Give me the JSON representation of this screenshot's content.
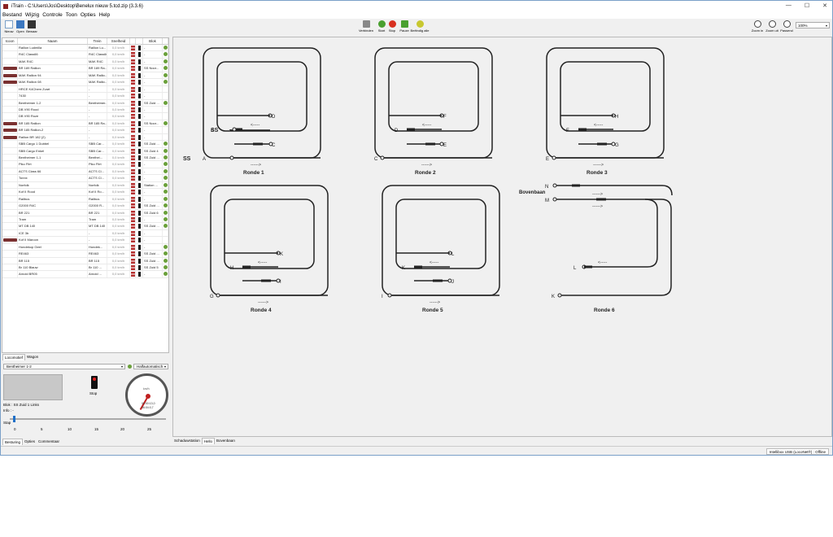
{
  "window": {
    "title": "iTrain - C:\\Users\\Jos\\Desktop\\Benelux nieuw 5.tcd.zip (3.3.6)",
    "controls": [
      "—",
      "☐",
      "✕"
    ]
  },
  "menu": [
    "Bestand",
    "Wijzig",
    "Controle",
    "Toon",
    "Opties",
    "Help"
  ],
  "toolbar": {
    "left": [
      "Nieuw",
      "Open",
      "Bewaar"
    ],
    "mid": [
      "Verbinden",
      "Start",
      "Stop",
      "Pauze",
      "Beëindig alle"
    ],
    "right": [
      "Zoom in",
      "Zoom uit",
      "Passend"
    ],
    "zoom": "100%"
  },
  "table": {
    "headers": [
      "Icoon",
      "Naam",
      "Trein",
      "Snelheid",
      "",
      "",
      "Blok",
      ""
    ],
    "rows": [
      {
        "name": "Railion Ludmilla",
        "train": "Railion Lu...",
        "speed": "0,0 km/h",
        "blk": "-",
        "loc": false,
        "dot": true
      },
      {
        "name": "R4C Class66",
        "train": "R4C Class66",
        "speed": "0,0 km/h",
        "blk": "-",
        "loc": false,
        "dot": true
      },
      {
        "name": "MAK R4C",
        "train": "MAK R4C",
        "speed": "0,0 km/h",
        "blk": "-",
        "loc": false,
        "dot": true
      },
      {
        "name": "BR 189 Railion",
        "train": "BR 189 Ra...",
        "speed": "0,0 km/h",
        "blk": "SS Noor...",
        "loc": true,
        "dot": true
      },
      {
        "name": "MAK Railion 94",
        "train": "MAK Railio...",
        "speed": "0,0 km/h",
        "blk": "-",
        "loc": true,
        "dot": true
      },
      {
        "name": "MAK Railion 08",
        "train": "MAK Railio...",
        "speed": "0,0 km/h",
        "blk": "-",
        "loc": true,
        "dot": true
      },
      {
        "name": "HRCE K4Chem Zvart",
        "train": "-",
        "speed": "0,0 km/h",
        "blk": "-",
        "loc": false,
        "dot": false
      },
      {
        "name": "7430",
        "train": "-",
        "speed": "0,0 km/h",
        "blk": "-",
        "loc": false,
        "dot": false
      },
      {
        "name": "Bentheimer 1-2",
        "train": "Bentheimer...",
        "speed": "0,0 km/h",
        "blk": "SS Zuid ...",
        "loc": false,
        "dot": true
      },
      {
        "name": "DB V90 Rood",
        "train": "-",
        "speed": "0,0 km/h",
        "blk": "-",
        "loc": false,
        "dot": false
      },
      {
        "name": "DB V90 Roze",
        "train": "-",
        "speed": "0,0 km/h",
        "blk": "-",
        "loc": false,
        "dot": false
      },
      {
        "name": "BR 185 Railion",
        "train": "BR 185 Ra...",
        "speed": "0,0 km/h",
        "blk": "SS Noor...",
        "loc": true,
        "dot": true
      },
      {
        "name": "BR 185 Railion-2",
        "train": "-",
        "speed": "0,0 km/h",
        "blk": "-",
        "loc": true,
        "dot": false
      },
      {
        "name": "Railion BR 182 (2)",
        "train": "-",
        "speed": "0,0 km/h",
        "blk": "-",
        "loc": true,
        "dot": false
      },
      {
        "name": "SBB Cargo 1 Dubbel",
        "train": "SBB Car...",
        "speed": "0,0 km/h",
        "blk": "SS Zuid ...",
        "loc": false,
        "dot": true
      },
      {
        "name": "SBB Cargo Enkel",
        "train": "SBB Car...",
        "speed": "0,0 km/h",
        "blk": "SS Zuid 4",
        "loc": false,
        "dot": true
      },
      {
        "name": "Bentheimer 1-1",
        "train": "Benthei...",
        "speed": "0,0 km/h",
        "blk": "SS Zuid ...",
        "loc": false,
        "dot": true
      },
      {
        "name": "Piko Flirt",
        "train": "Piko Flirt",
        "speed": "0,0 km/h",
        "blk": "-",
        "loc": false,
        "dot": true
      },
      {
        "name": "ACTS Class 66",
        "train": "ACTS Cl...",
        "speed": "0,0 km/h",
        "blk": "-",
        "loc": false,
        "dot": true
      },
      {
        "name": "Tonnx",
        "train": "ACTS Cl...",
        "speed": "0,0 km/h",
        "blk": "-",
        "loc": false,
        "dot": true
      },
      {
        "name": "Norfolk",
        "train": "Norfolk",
        "speed": "0,0 km/h",
        "blk": "Station ...",
        "loc": false,
        "dot": true
      },
      {
        "name": "Kof II Rood",
        "train": "Kof II Ro...",
        "speed": "0,0 km/h",
        "blk": "-",
        "loc": false,
        "dot": true
      },
      {
        "name": "Railbus",
        "train": "Railbus",
        "speed": "0,0 km/h",
        "blk": "-",
        "loc": false,
        "dot": true
      },
      {
        "name": "G2000 R4C",
        "train": "G2000 R...",
        "speed": "0,0 km/h",
        "blk": "SS Zuid ...",
        "loc": false,
        "dot": true
      },
      {
        "name": "BR 221",
        "train": "BR 221",
        "speed": "0,0 km/h",
        "blk": "SS Zuid 6",
        "loc": false,
        "dot": true
      },
      {
        "name": "Tram",
        "train": "Tram",
        "speed": "0,0 km/h",
        "blk": "-",
        "loc": false,
        "dot": true
      },
      {
        "name": "MT DB 140",
        "train": "MT DB 140",
        "speed": "0,0 km/h",
        "blk": "SS Zuid ...",
        "loc": false,
        "dot": true
      },
      {
        "name": "ICE 3b",
        "train": "-",
        "speed": "0,0 km/h",
        "blk": "-",
        "loc": false,
        "dot": false
      },
      {
        "name": "Kof II Maroon",
        "train": "-",
        "speed": "0,0 km/h",
        "blk": "-",
        "loc": true,
        "dot": false
      },
      {
        "name": "Hondekop Geel",
        "train": "Hondek...",
        "speed": "0,0 km/h",
        "blk": "-",
        "loc": false,
        "dot": true
      },
      {
        "name": "RE463",
        "train": "RE463",
        "speed": "0,0 km/h",
        "blk": "SS Zuid ...",
        "loc": false,
        "dot": true
      },
      {
        "name": "BR 115",
        "train": "BR 115",
        "speed": "0,0 km/h",
        "blk": "SS Zuid ...",
        "loc": false,
        "dot": true
      },
      {
        "name": "Br 110 Blauw",
        "train": "Br 110 ...",
        "speed": "0,0 km/h",
        "blk": "SS Zuid 5",
        "loc": false,
        "dot": true
      },
      {
        "name": "Arnold BR05",
        "train": "Arnold ...",
        "speed": "0,0 km/h",
        "blk": "-",
        "loc": false,
        "dot": true
      }
    ]
  },
  "left_tabs": [
    "Locomotief",
    "Wagon"
  ],
  "control": {
    "loco": "Bentheimer 1-2",
    "mode": "Halfautomatisch",
    "stop": "Stop",
    "blok": "Blok : SS Zuid 1 Links",
    "info": "Info : -",
    "stap": "Stap",
    "ticks": [
      "0",
      "5",
      "10",
      "15",
      "20",
      "25"
    ],
    "kmh": "km/h",
    "meter1": "00:00:13,0",
    "meter2": "36:04:0,7",
    "speed_level": 0
  },
  "control_tabs": [
    "Besturing",
    "Opties",
    "Commentaar"
  ],
  "layout": {
    "labels": [
      "SS",
      "A",
      "B",
      "C",
      "D",
      "E",
      "F",
      "G",
      "H",
      "I",
      "J",
      "K",
      "L",
      "M",
      "N",
      "SS",
      "Bovenbaan"
    ],
    "rondes": [
      "Ronde 1",
      "Ronde 2",
      "Ronde 3",
      "Ronde 4",
      "Ronde 5",
      "Ronde 6"
    ],
    "arrow_left": "<-----",
    "arrow_right": "------>"
  },
  "bottom_tabs": [
    "Schaduwstation",
    "Hello",
    "Bovenbaan"
  ],
  "status": "Intellibox USB (LocoNet®) : Offline",
  "colors": {
    "track": "#222222",
    "block": "#222222",
    "dot_green": "#6aa03a",
    "signal_red": "#e02020",
    "dir_red": "#b43030"
  }
}
